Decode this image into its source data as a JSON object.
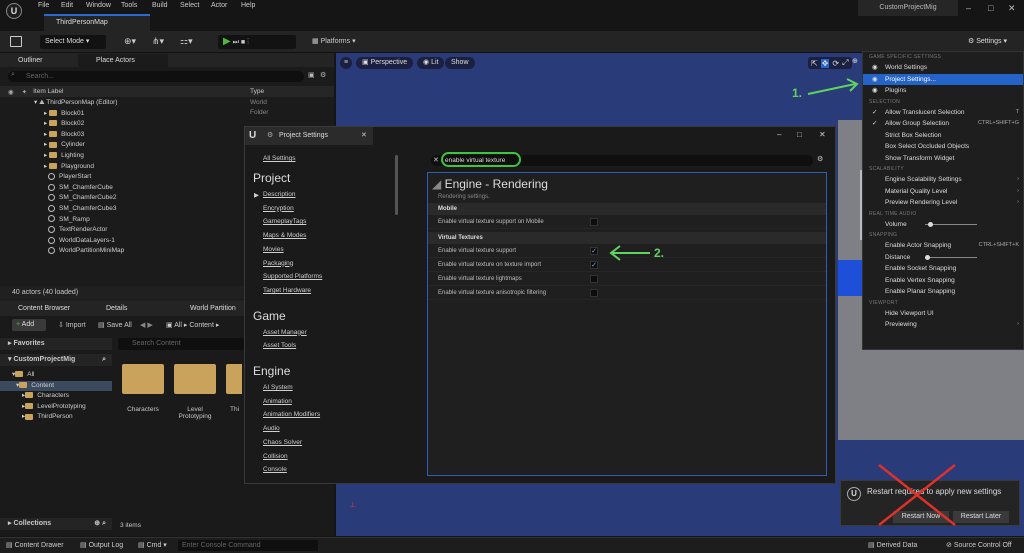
{
  "menu": [
    "File",
    "Edit",
    "Window",
    "Tools",
    "Build",
    "Select",
    "Actor",
    "Help"
  ],
  "doc_tab": "ThirdPersonMap",
  "project_name": "CustomProjectMig",
  "toolbar": {
    "select_mode": "Select Mode",
    "platforms": "Platforms",
    "settings": "Settings"
  },
  "outliner": {
    "tabs": [
      "Outliner",
      "Place Actors"
    ],
    "search_placeholder": "Search...",
    "col_label": "Item Label",
    "col_type": "Type",
    "root": "ThirdPersonMap (Editor)",
    "items": [
      {
        "label": "Block01",
        "kind": "folder"
      },
      {
        "label": "Block02",
        "kind": "folder"
      },
      {
        "label": "Block03",
        "kind": "folder"
      },
      {
        "label": "Cylinder",
        "kind": "folder"
      },
      {
        "label": "Lighting",
        "kind": "folder"
      },
      {
        "label": "Playground",
        "kind": "folder"
      },
      {
        "label": "PlayerStart",
        "kind": "actor"
      },
      {
        "label": "SM_ChamferCube",
        "kind": "actor"
      },
      {
        "label": "SM_ChamferCube2",
        "kind": "actor"
      },
      {
        "label": "SM_ChamferCube3",
        "kind": "actor"
      },
      {
        "label": "SM_Ramp",
        "kind": "actor"
      },
      {
        "label": "TextRenderActor",
        "kind": "actor"
      },
      {
        "label": "WorldDataLayers-1",
        "kind": "actor"
      },
      {
        "label": "WorldPartitionMiniMap",
        "kind": "actor"
      }
    ],
    "types": [
      "World",
      "Folder"
    ],
    "footer": "40 actors (40 loaded)"
  },
  "content_browser": {
    "tabs": [
      "Content Browser",
      "Details",
      "World Partition"
    ],
    "add": "Add",
    "import": "Import",
    "save_all": "Save All",
    "path": [
      "All",
      "Content"
    ],
    "favorites": "Favorites",
    "project": "CustomProjectMig",
    "tree": [
      "All",
      "Content",
      "Characters",
      "LevelPrototyping",
      "ThirdPerson"
    ],
    "search_placeholder": "Search Content",
    "assets": [
      "Characters",
      "Level Prototyping",
      "Thi"
    ],
    "collections": "Collections",
    "count": "3 items"
  },
  "viewport": {
    "perspective": "Perspective",
    "lit": "Lit",
    "show": "Show"
  },
  "project_settings": {
    "title": "Project Settings",
    "all_settings": "All Settings",
    "sections": [
      {
        "head": "Project",
        "items": [
          "Description",
          "Encryption",
          "GameplayTags",
          "Maps & Modes",
          "Movies",
          "Packaging",
          "Supported Platforms",
          "Target Hardware"
        ]
      },
      {
        "head": "Game",
        "items": [
          "Asset Manager",
          "Asset Tools"
        ]
      },
      {
        "head": "Engine",
        "items": [
          "AI System",
          "Animation",
          "Animation Modifiers",
          "Audio",
          "Chaos Solver",
          "Collision",
          "Console"
        ]
      }
    ],
    "search_value": "enable virtual texture",
    "page_title": "Engine - Rendering",
    "page_sub": "Rendering settings.",
    "groups": [
      {
        "name": "Mobile",
        "props": [
          {
            "label": "Enable virtual texture support on Mobile",
            "checked": false
          }
        ]
      },
      {
        "name": "Virtual Textures",
        "props": [
          {
            "label": "Enable virtual texture support",
            "checked": true
          },
          {
            "label": "Enable virtual texture on texture import",
            "checked": true
          },
          {
            "label": "Enable virtual texture lightmaps",
            "checked": false
          },
          {
            "label": "Enable virtual texture anisotropic filtering",
            "checked": false
          }
        ]
      }
    ]
  },
  "settings_menu": {
    "groups": [
      {
        "head": "GAME SPECIFIC SETTINGS",
        "items": [
          {
            "label": "World Settings"
          },
          {
            "label": "Project Settings...",
            "selected": true
          },
          {
            "label": "Plugins"
          }
        ]
      },
      {
        "head": "SELECTION",
        "items": [
          {
            "label": "Allow Translucent Selection",
            "check": true,
            "shortcut": "T"
          },
          {
            "label": "Allow Group Selection",
            "check": true,
            "shortcut": "CTRL+SHIFT+G"
          },
          {
            "label": "Strict Box Selection"
          },
          {
            "label": "Box Select Occluded Objects"
          },
          {
            "label": "Show Transform Widget"
          }
        ]
      },
      {
        "head": "SCALABILITY",
        "items": [
          {
            "label": "Engine Scalability Settings",
            "arrow": true
          },
          {
            "label": "Material Quality Level",
            "arrow": true
          },
          {
            "label": "Preview Rendering Level",
            "arrow": true
          }
        ]
      },
      {
        "head": "REAL TIME AUDIO",
        "items": [
          {
            "label": "Volume",
            "slider": 0.05
          }
        ]
      },
      {
        "head": "SNAPPING",
        "items": [
          {
            "label": "Enable Actor Snapping",
            "shortcut": "CTRL+SHIFT+K"
          },
          {
            "label": "Distance",
            "slider": 0.0
          },
          {
            "label": "Enable Socket Snapping"
          },
          {
            "label": "Enable Vertex Snapping"
          },
          {
            "label": "Enable Planar Snapping"
          }
        ]
      },
      {
        "head": "VIEWPORT",
        "items": [
          {
            "label": "Hide Viewport UI"
          },
          {
            "label": "Previewing",
            "arrow": true
          }
        ]
      }
    ]
  },
  "notification": {
    "text": "Restart required to apply new settings",
    "restart_now": "Restart Now",
    "restart_later": "Restart Later"
  },
  "annotations": {
    "one": "1.",
    "two": "2."
  },
  "bottom": {
    "content_drawer": "Content Drawer",
    "output_log": "Output Log",
    "cmd": "Cmd",
    "console_placeholder": "Enter Console Command",
    "derived_data": "Derived Data",
    "source_control": "Source Control Off"
  }
}
